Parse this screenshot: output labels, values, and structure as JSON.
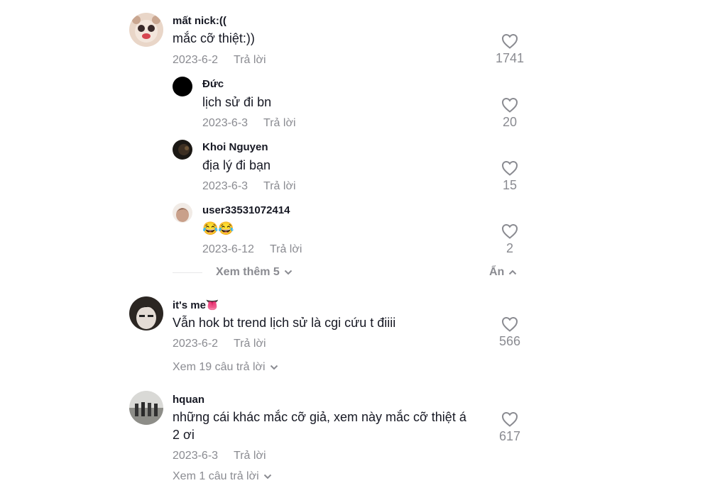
{
  "comments": [
    {
      "username": "mất nick:((",
      "text": "mắc cỡ thiệt:))",
      "date": "2023-6-2",
      "reply_label": "Trả lời",
      "likes": "1741",
      "replies": [
        {
          "username": "Đức",
          "text": "lịch sử đi bn",
          "date": "2023-6-3",
          "reply_label": "Trả lời",
          "likes": "20"
        },
        {
          "username": "Khoi Nguyen",
          "text": "địa lý đi bạn",
          "date": "2023-6-3",
          "reply_label": "Trả lời",
          "likes": "15"
        },
        {
          "username": "user33531072414",
          "text": "😂😂",
          "date": "2023-6-12",
          "reply_label": "Trả lời",
          "likes": "2"
        }
      ],
      "view_more_label": "Xem thêm 5",
      "hide_label": "Ẩn"
    },
    {
      "username": "it's me👅",
      "text": "Vẫn hok bt trend lịch sử là cgi cứu t điiii",
      "date": "2023-6-2",
      "reply_label": "Trả lời",
      "likes": "566",
      "view_replies_label": "Xem 19 câu trả lời"
    },
    {
      "username": "hquan",
      "text_line1": "những cái khác mắc cỡ giả, xem này mắc cỡ thiệt á",
      "text_line2": "2 ơi",
      "date": "2023-6-3",
      "reply_label": "Trả lời",
      "likes": "617",
      "view_replies_label": "Xem 1 câu trả lời"
    }
  ],
  "icons": {
    "like": "heart-outline-icon",
    "expand": "chevron-down-icon",
    "collapse": "chevron-up-icon"
  },
  "colors": {
    "text": "#161823",
    "muted": "#8a8b91"
  }
}
